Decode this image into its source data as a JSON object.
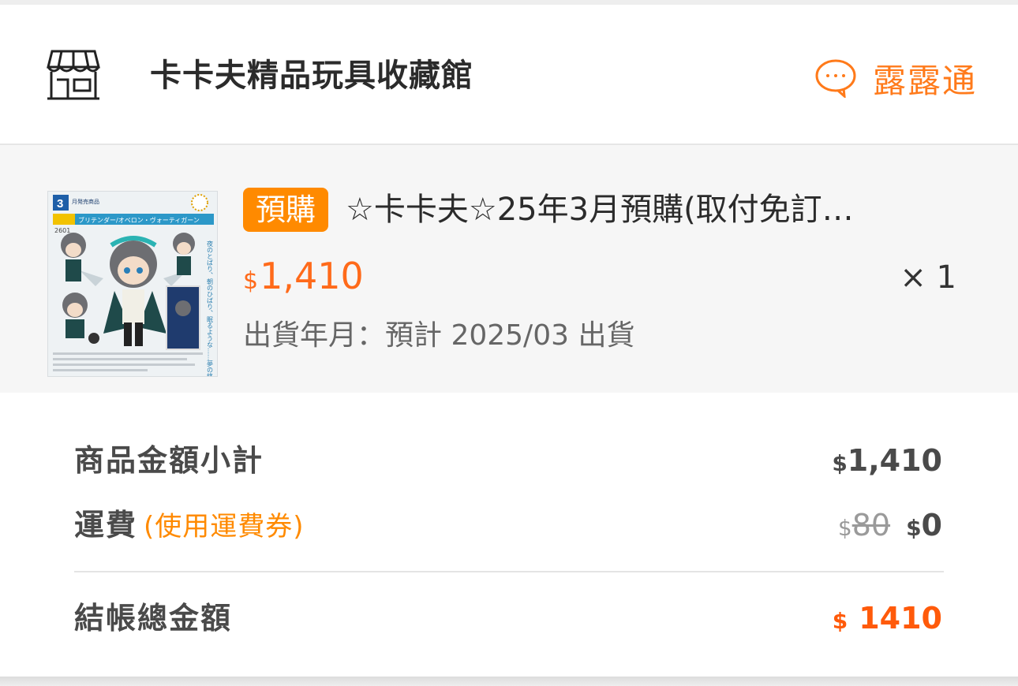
{
  "shop": {
    "icon": "storefront-icon",
    "name": "卡卡夫精品玩具收藏館",
    "chat_icon": "chat-bubble-icon",
    "chat_label": "露露通"
  },
  "product": {
    "tag": "預購",
    "title": "☆卡卡夫☆25年3月預購(取付免訂…",
    "price_currency": "$",
    "price": "1,410",
    "quantity": "× 1",
    "ship_date": "出貨年月：預計 2025/03 出貨",
    "image": {
      "badge_number": "3",
      "badge_text": "月発売商品",
      "banner_text": "ブリテンダー/オベロン・ヴォーティガーン",
      "vertical_text": "夜のとばり、朝のひばり、眠るような……夢の終わり",
      "code": "2601"
    }
  },
  "summary": {
    "subtotal_label": "商品金額小計",
    "subtotal_currency": "$",
    "subtotal_value": "1,410",
    "shipping_label": "運費",
    "shipping_note": "(使用運費券)",
    "shipping_original_currency": "$",
    "shipping_original": "80",
    "shipping_currency": "$",
    "shipping_value": "0",
    "total_label": "結帳總金額",
    "total_currency": "$",
    "total_value": "1410"
  },
  "colors": {
    "accent": "#ff7a1a",
    "tag_bg": "#ff8a00",
    "price": "#ff6a1a"
  }
}
